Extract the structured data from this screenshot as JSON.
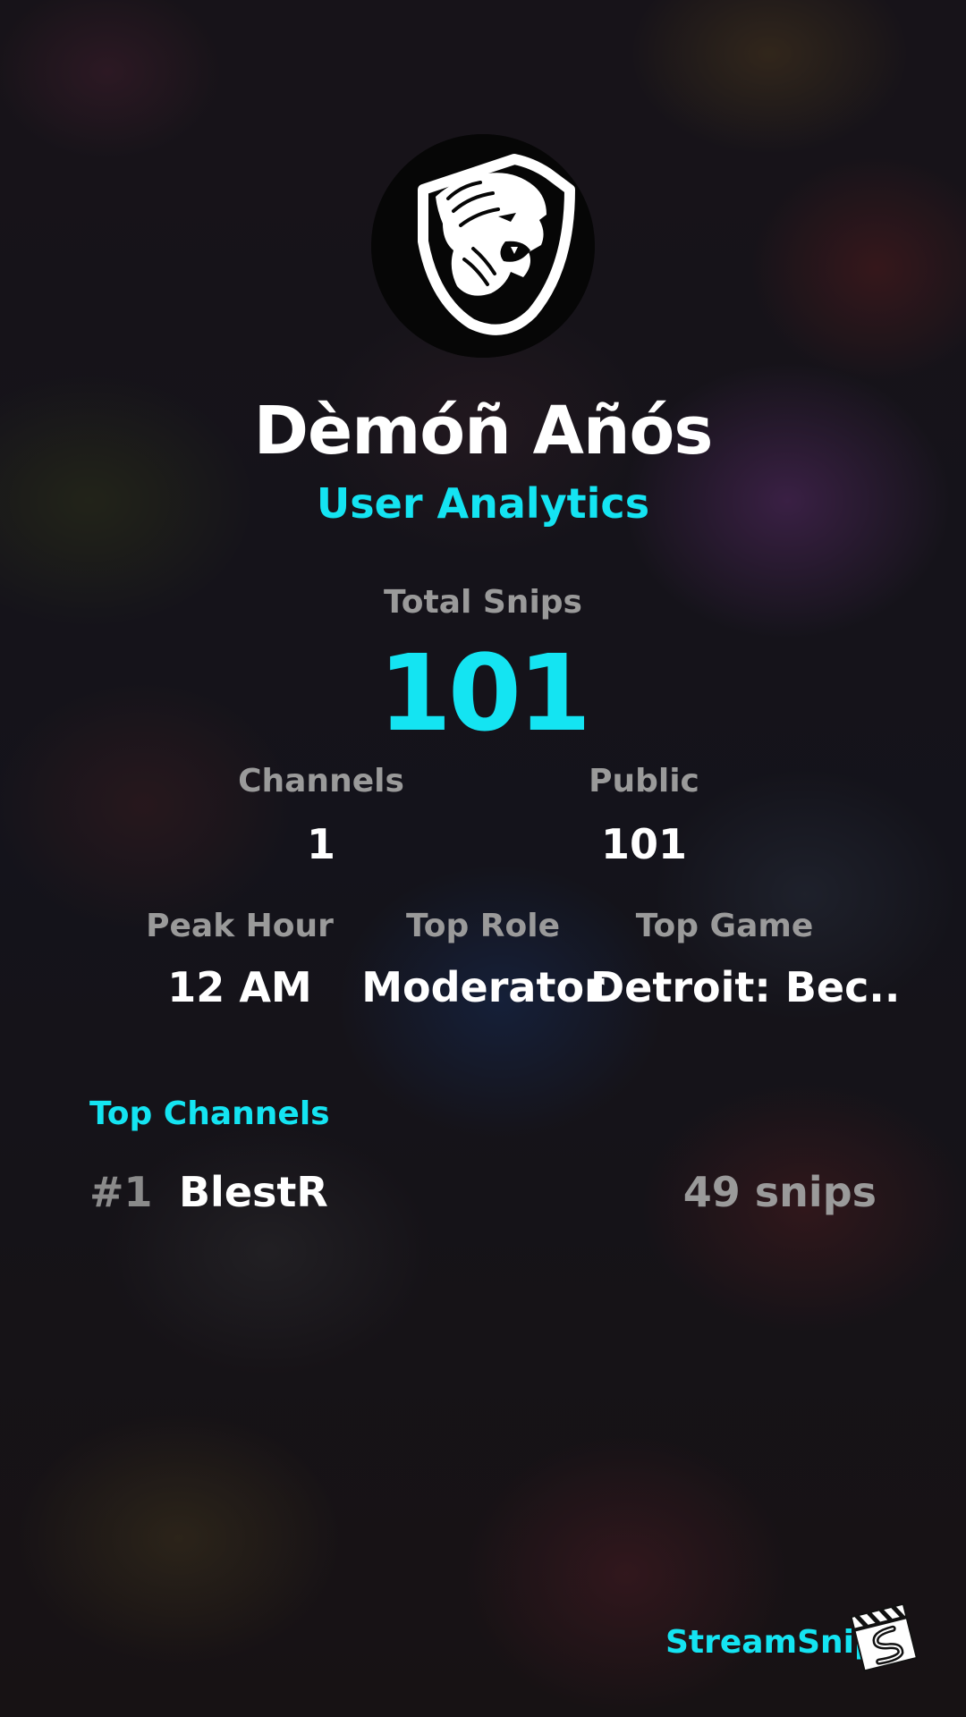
{
  "profile": {
    "display_name": "Dèmóñ Añós",
    "subtitle": "User Analytics",
    "avatar_icon": "lion-shield-icon"
  },
  "totals": {
    "label": "Total Snips",
    "value": "101"
  },
  "stats_row1": [
    {
      "label": "Channels",
      "value": "1"
    },
    {
      "label": "Public",
      "value": "101"
    }
  ],
  "stats_row2": [
    {
      "label": "Peak Hour",
      "value": "12 AM"
    },
    {
      "label": "Top Role",
      "value": "Moderator"
    },
    {
      "label": "Top Game",
      "value": "Detroit: Bec.."
    }
  ],
  "top_channels": {
    "title": "Top Channels",
    "items": [
      {
        "rank": "#1",
        "name": "BlestR",
        "count": "49 snips"
      }
    ]
  },
  "brand": {
    "name": "StreamSnip",
    "logo_icon": "clapperboard-icon"
  },
  "colors": {
    "accent": "#14e4f2",
    "muted": "#9a9a9a",
    "text": "#ffffff"
  }
}
